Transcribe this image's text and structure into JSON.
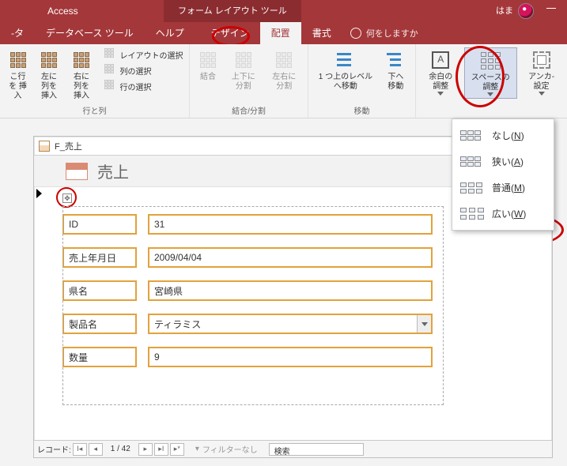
{
  "title": {
    "app": "Access",
    "contextTab": "フォーム レイアウト ツール",
    "user": "はま"
  },
  "tabs": {
    "t0": "-タ",
    "t1": "データベース ツール",
    "t2": "ヘルプ",
    "t3": "デザイン",
    "t4": "配置",
    "t5": "書式",
    "tell": "何をしますか"
  },
  "ribbon": {
    "group_rowscols": "行と列",
    "insert_above": "こ行を\n挿入",
    "insert_left": "左に列を\n挿入",
    "insert_right": "右に列を\n挿入",
    "sel_layout": "レイアウトの選択",
    "sel_col": "列の選択",
    "sel_row": "行の選択",
    "group_merge": "結合/分割",
    "merge": "結合",
    "split_v": "上下に\n分割",
    "split_h": "左右に\n分割",
    "group_move": "移動",
    "move_up": "1 つ上のレベル\nへ移動",
    "move_down": "下へ移動",
    "group_pos": "余白の\n調整",
    "space": "スペースの\n調整",
    "anchor": "アンカ-\n設定"
  },
  "dropdown": {
    "none": "なし",
    "none_k": "N",
    "narrow": "狭い",
    "narrow_k": "A",
    "normal": "普通",
    "normal_k": "M",
    "wide": "広い",
    "wide_k": "W"
  },
  "window": {
    "tabName": "F_売上",
    "heading": "売上"
  },
  "fields": {
    "id_l": "ID",
    "id_v": "31",
    "date_l": "売上年月日",
    "date_v": "2009/04/04",
    "pref_l": "県名",
    "pref_v": "宮崎県",
    "prod_l": "製品名",
    "prod_v": "ティラミス",
    "qty_l": "数量",
    "qty_v": "9"
  },
  "recordbar": {
    "label": "レコード:",
    "pos": "1 / 42",
    "filter": "フィルターなし",
    "search": "検索"
  }
}
